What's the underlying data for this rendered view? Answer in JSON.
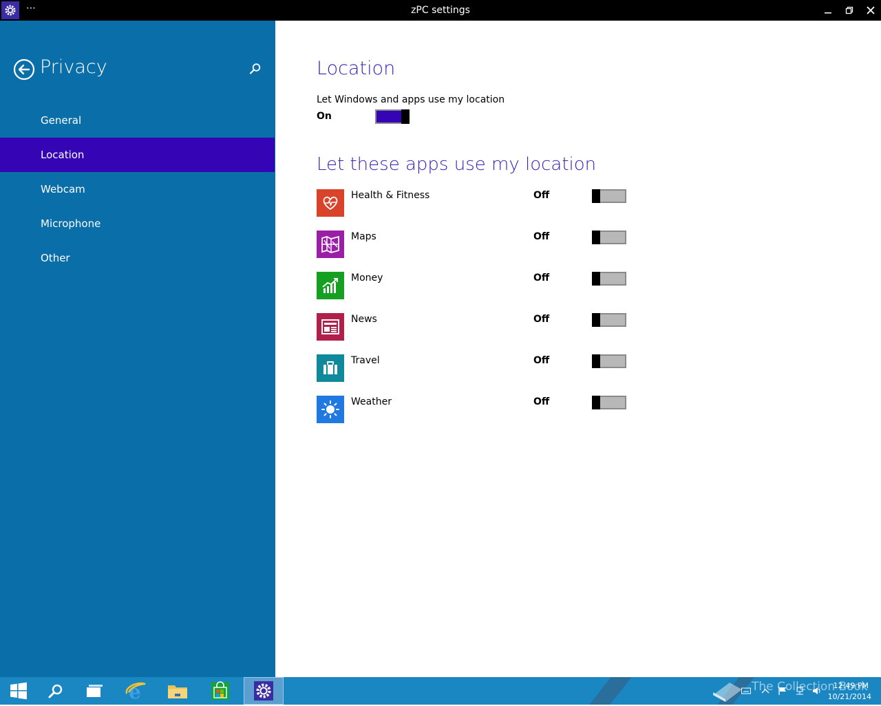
{
  "window": {
    "title": "zPC settings",
    "menu_label": "⋯"
  },
  "sidebar": {
    "title": "Privacy",
    "items": [
      {
        "label": "General"
      },
      {
        "label": "Location"
      },
      {
        "label": "Webcam"
      },
      {
        "label": "Microphone"
      },
      {
        "label": "Other"
      }
    ],
    "selected": "Location"
  },
  "main": {
    "heading": "Location",
    "master_description": "Let Windows and apps use my location",
    "master_state": "On",
    "apps_heading": "Let these apps use my location",
    "apps": [
      {
        "name": "Health & Fitness",
        "state": "Off",
        "icon": "heart-pulse-icon",
        "color": "#d9432a"
      },
      {
        "name": "Maps",
        "state": "Off",
        "icon": "map-icon",
        "color": "#9b1ea6"
      },
      {
        "name": "Money",
        "state": "Off",
        "icon": "chart-icon",
        "color": "#16a021"
      },
      {
        "name": "News",
        "state": "Off",
        "icon": "newspaper-icon",
        "color": "#b0204a"
      },
      {
        "name": "Travel",
        "state": "Off",
        "icon": "suitcase-icon",
        "color": "#108a9a"
      },
      {
        "name": "Weather",
        "state": "Off",
        "icon": "sun-icon",
        "color": "#1f79e0"
      }
    ]
  },
  "taskbar": {
    "watermark": "The Collection Book",
    "time": "12:49 PM",
    "date": "10/21/2014"
  },
  "colors": {
    "sidebar_bg": "#0a6ea9",
    "accent": "#3504b5",
    "heading": "#3a1fbb",
    "taskbar": "#1a87c2"
  }
}
